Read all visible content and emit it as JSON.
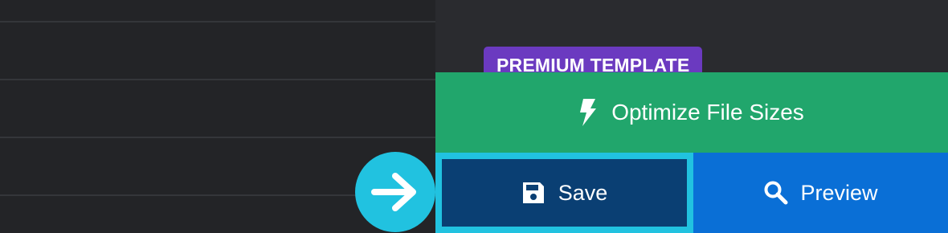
{
  "badge": {
    "label": "PREMIUM TEMPLATE"
  },
  "actions": {
    "optimize_label": "Optimize File Sizes",
    "save_label": "Save",
    "preview_label": "Preview"
  },
  "icons": {
    "optimize": "lightning-bolt-icon",
    "save": "floppy-disk-icon",
    "preview": "magnifier-icon",
    "pointer": "arrow-right-icon"
  },
  "colors": {
    "optimize": "#21a66c",
    "save": "#0a3f73",
    "save_highlight": "#21c2e0",
    "preview": "#0a6fd6",
    "badge": "#6b3ac0"
  }
}
